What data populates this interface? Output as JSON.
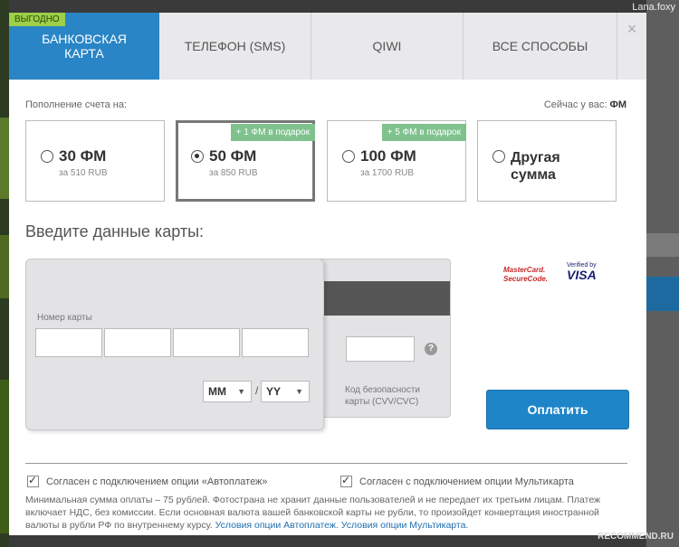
{
  "user": "Lana.foxy",
  "tabs": {
    "badge": "ВЫГОДНО",
    "bank_card_line1": "БАНКОВСКАЯ",
    "bank_card_line2": "КАРТА",
    "phone": "ТЕЛЕФОН (SMS)",
    "qiwi": "QIWI",
    "all": "ВСЕ СПОСОБЫ",
    "close": "×"
  },
  "top": {
    "title": "Пополнение счета на:",
    "balance_label": "Сейчас у вас:",
    "balance_value": "ФМ"
  },
  "options": [
    {
      "amount": "30 ФМ",
      "price": "за 510 RUB",
      "gift": "",
      "selected": false
    },
    {
      "amount": "50 ФМ",
      "price": "за 850 RUB",
      "gift": "+ 1 ФМ в подарок",
      "selected": true
    },
    {
      "amount": "100 ФМ",
      "price": "за 1700 RUB",
      "gift": "+ 5 ФМ в подарок",
      "selected": false
    },
    {
      "amount_line1": "Другая",
      "amount_line2": "сумма",
      "selected": false
    }
  ],
  "card": {
    "title": "Введите данные карты:",
    "number_label": "Номер карты",
    "month": "MM",
    "year": "YY",
    "slash": "/",
    "cvv_label": "Код безопасности карты (CVV/CVC)",
    "help": "?"
  },
  "logos": {
    "mastercard_line1": "MasterCard.",
    "mastercard_line2": "SecureCode.",
    "verified_line": "Verified by",
    "visa": "VISA"
  },
  "pay_button": "Оплатить",
  "checkboxes": {
    "autopay": "Согласен с подключением опции «Автоплатеж»",
    "multicard": "Согласен с подключением опции Мультикарта"
  },
  "footer": {
    "text": "Минимальная сумма оплаты – 75 рублей. Фотострана не хранит данные пользователей и не передает их третьим лицам. Платеж включает НДС, без комиссии. Если основная валюта вашей банковской карты не рубли, то произойдет конвертация иностранной валюты в рубли РФ по внутреннему курсу.",
    "link1": "Условия опции Автоплатеж.",
    "link2": "Условия опции Мультикарта."
  },
  "watermark": "RECOMMEND.RU"
}
